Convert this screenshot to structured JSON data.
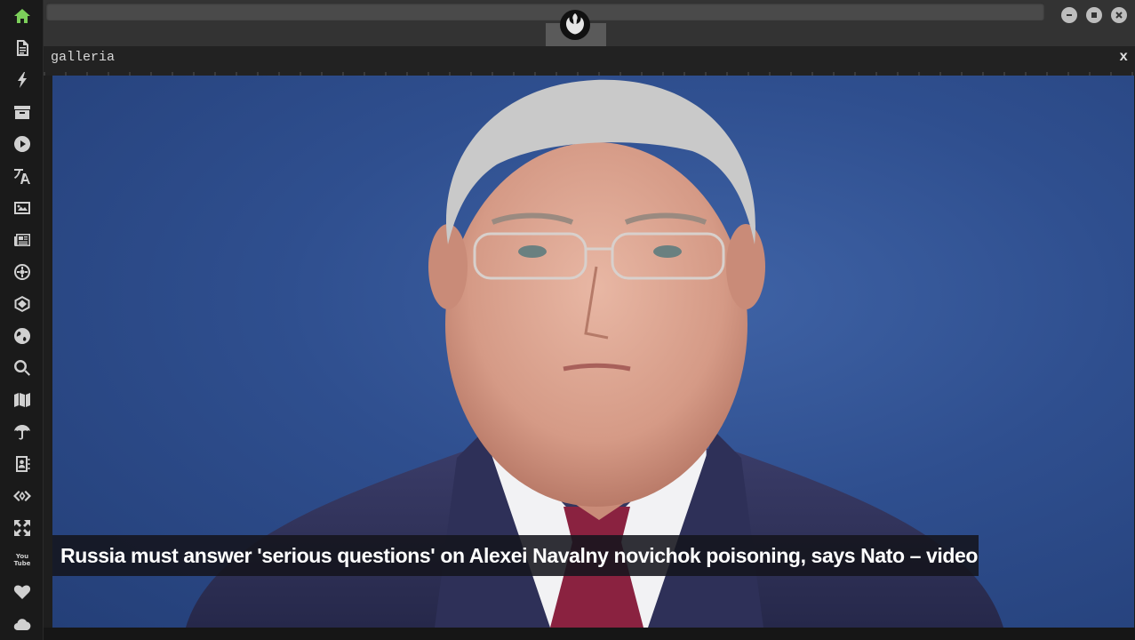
{
  "sidebar": {
    "items": [
      {
        "name": "home",
        "icon": "home-icon",
        "active": true
      },
      {
        "name": "document",
        "icon": "document-icon"
      },
      {
        "name": "flash",
        "icon": "lightning-icon"
      },
      {
        "name": "archive",
        "icon": "archive-icon"
      },
      {
        "name": "play",
        "icon": "play-circle-icon"
      },
      {
        "name": "translate",
        "icon": "translate-icon"
      },
      {
        "name": "image",
        "icon": "image-icon"
      },
      {
        "name": "news",
        "icon": "newspaper-icon"
      },
      {
        "name": "empire",
        "icon": "empire-icon"
      },
      {
        "name": "hex",
        "icon": "hexagon-icon"
      },
      {
        "name": "globe",
        "icon": "globe-icon"
      },
      {
        "name": "search",
        "icon": "search-icon"
      },
      {
        "name": "map",
        "icon": "map-icon"
      },
      {
        "name": "umbrella",
        "icon": "umbrella-icon"
      },
      {
        "name": "contacts",
        "icon": "address-book-icon"
      },
      {
        "name": "code",
        "icon": "code-icon"
      },
      {
        "name": "expand",
        "icon": "expand-icon"
      },
      {
        "name": "youtube",
        "icon": "youtube-icon"
      },
      {
        "name": "favorites",
        "icon": "heart-icon"
      },
      {
        "name": "cloud",
        "icon": "cloud-icon"
      }
    ],
    "youtube_text": [
      "You",
      "Tube"
    ],
    "active_color": "#7ccf5a",
    "icon_color": "#d0d0d0"
  },
  "topbar": {
    "logo_icon": "rebel-alliance-icon",
    "window_buttons": [
      "minimize-icon",
      "maximize-icon",
      "close-icon"
    ]
  },
  "panel": {
    "title": "galleria",
    "close_label": "x"
  },
  "gallery": {
    "caption": "Russia must answer 'serious questions' on Alexei Navalny novichok poisoning, says Nato – video",
    "background_color": "#2f4f8f"
  }
}
